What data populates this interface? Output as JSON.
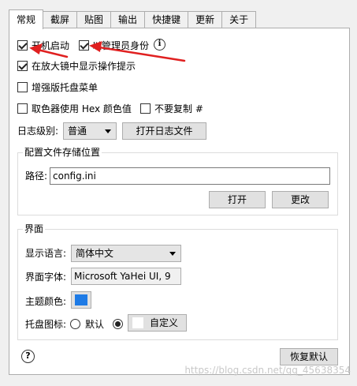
{
  "tabs": [
    {
      "label": "常规"
    },
    {
      "label": "截屏"
    },
    {
      "label": "贴图"
    },
    {
      "label": "输出"
    },
    {
      "label": "快捷键"
    },
    {
      "label": "更新"
    },
    {
      "label": "关于"
    }
  ],
  "general": {
    "autostart": {
      "label": "开机启动",
      "checked": true
    },
    "admin": {
      "label": "以管理员身份",
      "checked": true
    },
    "magnifier_tip": {
      "label": "在放大镜中显示操作提示",
      "checked": true
    },
    "enhanced_tray": {
      "label": "增强版托盘菜单",
      "checked": false
    },
    "hex_color": {
      "label": "取色器使用 Hex 颜色值",
      "checked": false
    },
    "no_copy_hash": {
      "label": "不要复制 #",
      "checked": false
    }
  },
  "log": {
    "label": "日志级别:",
    "level": "普通",
    "open_button": "打开日志文件"
  },
  "config": {
    "group_title": "配置文件存储位置",
    "path_label": "路径:",
    "path_value": "config.ini",
    "open_button": "打开",
    "change_button": "更改"
  },
  "ui": {
    "group_title": "界面",
    "language_label": "显示语言:",
    "language_value": "简体中文",
    "font_label": "界面字体:",
    "font_value": "Microsoft YaHei UI, 9",
    "theme_label": "主题颜色:",
    "theme_color": "#1e7be6",
    "tray_label": "托盘图标:",
    "tray_default": "默认",
    "tray_custom": "自定义"
  },
  "footer": {
    "help_icon": "help-icon",
    "restore_button": "恢复默认"
  },
  "watermark": "https://blog.csdn.net/qq_45638354"
}
